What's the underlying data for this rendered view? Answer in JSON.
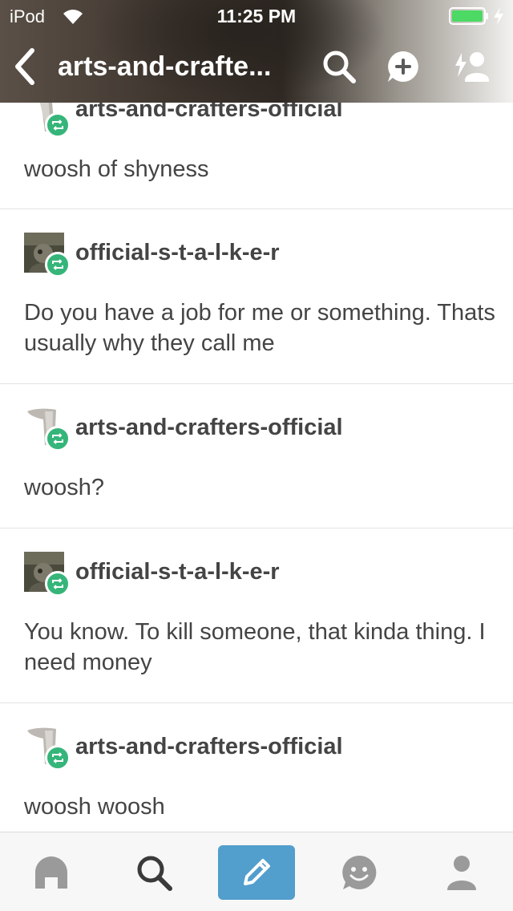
{
  "status_bar": {
    "carrier": "iPod",
    "time": "11:25 PM",
    "battery_level": 1.0
  },
  "nav": {
    "title": "arts-and-crafte...",
    "icons": [
      "back-chevron-icon",
      "search-icon",
      "add-comment-icon",
      "add-participant-icon"
    ]
  },
  "messages": [
    {
      "username": "arts-and-crafters-official",
      "text": "woosh of shyness",
      "avatar": "arts-avatar"
    },
    {
      "username": "official-s-t-a-l-k-e-r",
      "text": "Do you have a job for me or something. Thats usually why they call me",
      "avatar": "stalker-avatar"
    },
    {
      "username": "arts-and-crafters-official",
      "text": "woosh?",
      "avatar": "arts-avatar"
    },
    {
      "username": "official-s-t-a-l-k-e-r",
      "text": "You know. To kill someone, that kinda thing. I need money",
      "avatar": "stalker-avatar"
    },
    {
      "username": "arts-and-crafters-official",
      "text": "woosh woosh",
      "avatar": "arts-avatar"
    }
  ],
  "tabbar": {
    "tabs": [
      "home-icon",
      "search-icon",
      "compose-pencil-icon",
      "activity-smiley-icon",
      "account-person-icon"
    ],
    "compose_color": "#529ecc"
  },
  "colors": {
    "reblog_badge": "#36b57a",
    "battery": "#4cd964",
    "text": "#444444"
  }
}
